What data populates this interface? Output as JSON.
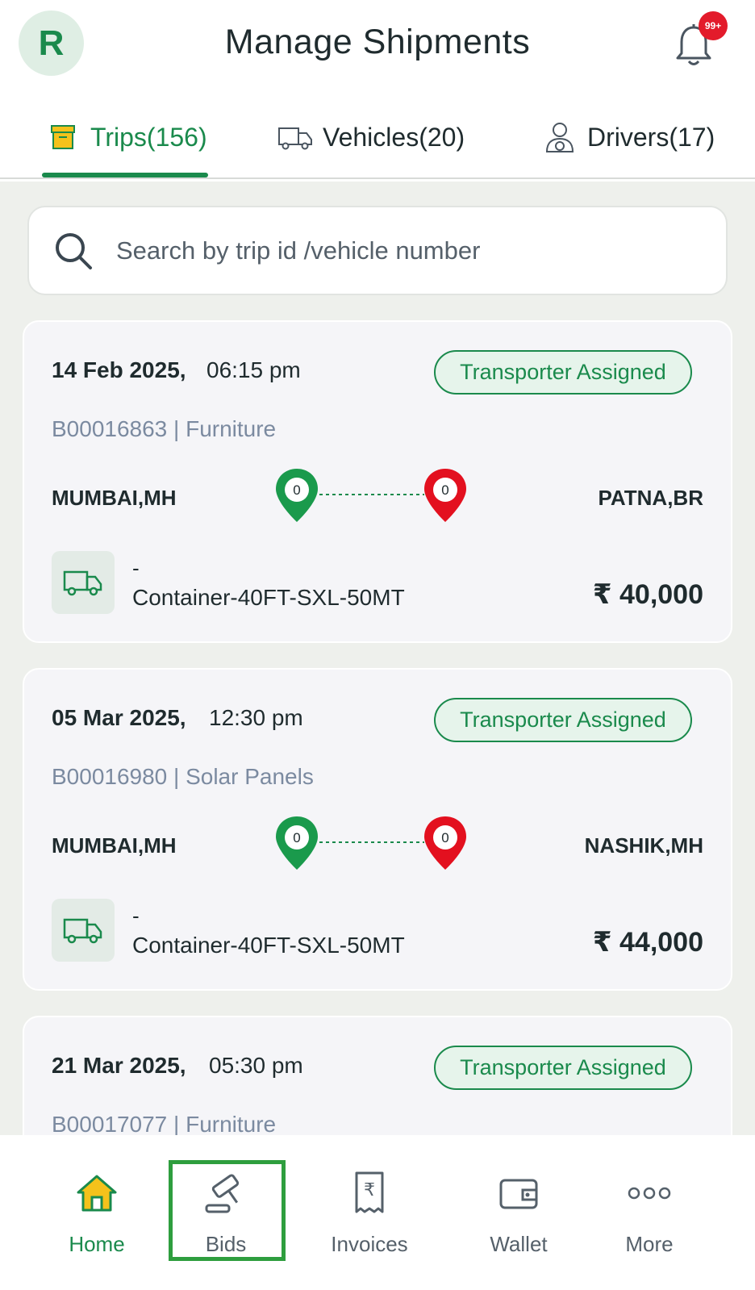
{
  "header": {
    "avatar_letter": "R",
    "title": "Manage Shipments",
    "notification_badge": "99+"
  },
  "tabs": [
    {
      "label": "Trips(156)",
      "icon": "box-icon",
      "active": true
    },
    {
      "label": "Vehicles(20)",
      "icon": "truck-icon",
      "active": false
    },
    {
      "label": "Drivers(17)",
      "icon": "driver-icon",
      "active": false
    }
  ],
  "search": {
    "placeholder": "Search by trip id /vehicle number"
  },
  "trips": [
    {
      "date": "14 Feb 2025,",
      "time": "06:15 pm",
      "status": "Transporter Assigned",
      "id_line": "B00016863 | Furniture",
      "from": "MUMBAI,MH",
      "to": "PATNA,BR",
      "from_count": "0",
      "to_count": "0",
      "vehicle_number": "-",
      "vehicle_type": "Container-40FT-SXL-50MT",
      "price": "₹ 40,000"
    },
    {
      "date": "05 Mar 2025,",
      "time": "12:30 pm",
      "status": "Transporter Assigned",
      "id_line": "B00016980 | Solar Panels",
      "from": "MUMBAI,MH",
      "to": "NASHIK,MH",
      "from_count": "0",
      "to_count": "0",
      "vehicle_number": "-",
      "vehicle_type": "Container-40FT-SXL-50MT",
      "price": "₹ 44,000"
    },
    {
      "date": "21 Mar 2025,",
      "time": "05:30 pm",
      "status": "Transporter Assigned",
      "id_line": "B00017077 | Furniture"
    }
  ],
  "bottom_nav": [
    {
      "label": "Home",
      "icon": "home-icon",
      "active": true
    },
    {
      "label": "Bids",
      "icon": "gavel-icon",
      "active": false
    },
    {
      "label": "Invoices",
      "icon": "receipt-icon",
      "active": false
    },
    {
      "label": "Wallet",
      "icon": "wallet-icon",
      "active": false
    },
    {
      "label": "More",
      "icon": "more-icon",
      "active": false
    }
  ],
  "colors": {
    "brand_green": "#1a8a4c",
    "pin_green": "#1a9a4c",
    "pin_red": "#e3101f",
    "badge_red": "#e31b2b",
    "highlight_box": "#2e9e3e"
  }
}
